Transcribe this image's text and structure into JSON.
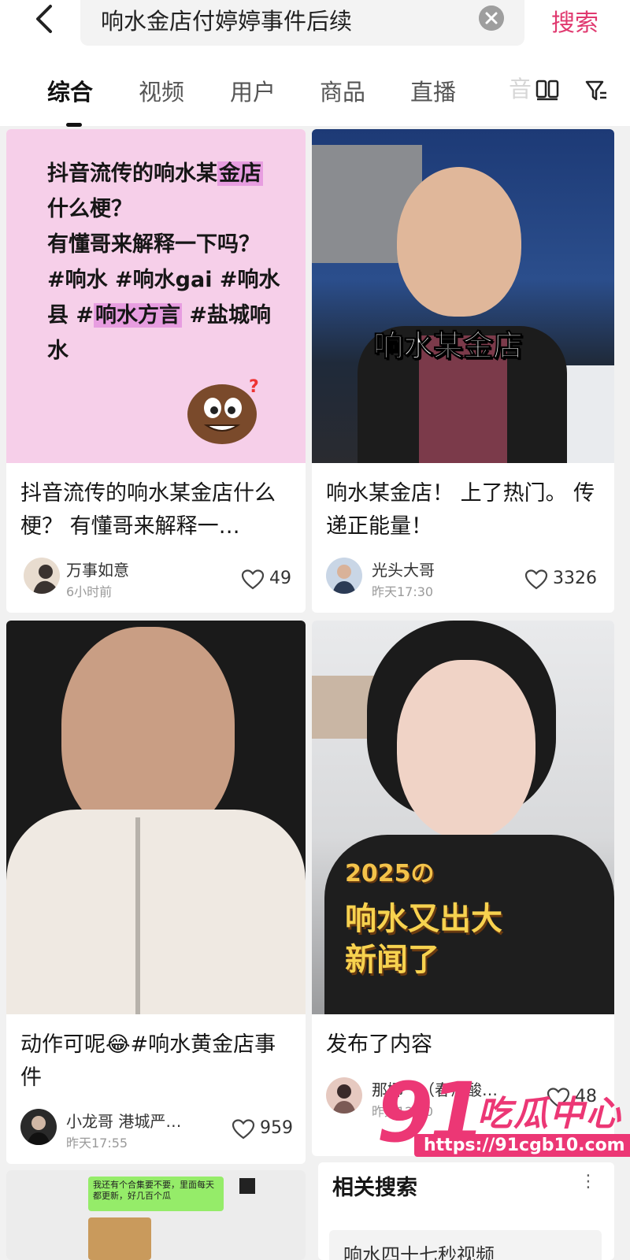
{
  "search": {
    "query": "响水金店付婷婷事件后续",
    "button_label": "搜索"
  },
  "tabs": [
    {
      "label": "综合",
      "active": true
    },
    {
      "label": "视频"
    },
    {
      "label": "用户"
    },
    {
      "label": "商品"
    },
    {
      "label": "直播"
    }
  ],
  "tab_overflow_glyph": "音",
  "icons": {
    "back": "chevron-left-icon",
    "clear": "clear-icon",
    "layout": "grid-toggle-icon",
    "filter": "filter-icon",
    "like": "heart-icon"
  },
  "colors": {
    "accent": "#e0396f",
    "watermark": "#ec3775",
    "card1_bg": "#f6cfe9",
    "highlight": "#e79de0"
  },
  "cards": [
    {
      "thumb_lines": [
        "抖音流传的响水某",
        "金店",
        "什么梗？",
        "有懂哥来解释一下吗？",
        "#响水 #响水gai #响水",
        "县 #",
        "响水方言",
        " #盐城响",
        "水"
      ],
      "title": "抖音流传的响水某金店什么梗？ 有懂哥来解释一…",
      "author": "万事如意",
      "time": "6小时前",
      "likes": "49"
    },
    {
      "overlay": "响水某金店",
      "title": "响水某金店！ 上了热门。 传递正能量！",
      "author": "光头大哥",
      "time": "昨天17:30",
      "likes": "3326"
    },
    {
      "title": "动作可呢😂#响水黄金店事件",
      "author": "小龙哥 港城严…",
      "time": "昨天17:55",
      "likes": "959"
    },
    {
      "overlay_year": "2025の",
      "overlay_line1": "响水又出大",
      "overlay_line2": "新闻了",
      "title": "发布了内容",
      "author": "那娜一（春海酸…",
      "time": "昨天12:30",
      "likes": "48"
    },
    {
      "chat_bubble": "我还有个合集要不要，里面每天都更新，好几百个瓜"
    }
  ],
  "related": {
    "title": "相关搜索",
    "more": "⋮",
    "first_item": "响水四十七秒视频"
  },
  "watermark": {
    "number": "91",
    "text": "吃瓜中心",
    "url": "https://91cgb10.com"
  }
}
